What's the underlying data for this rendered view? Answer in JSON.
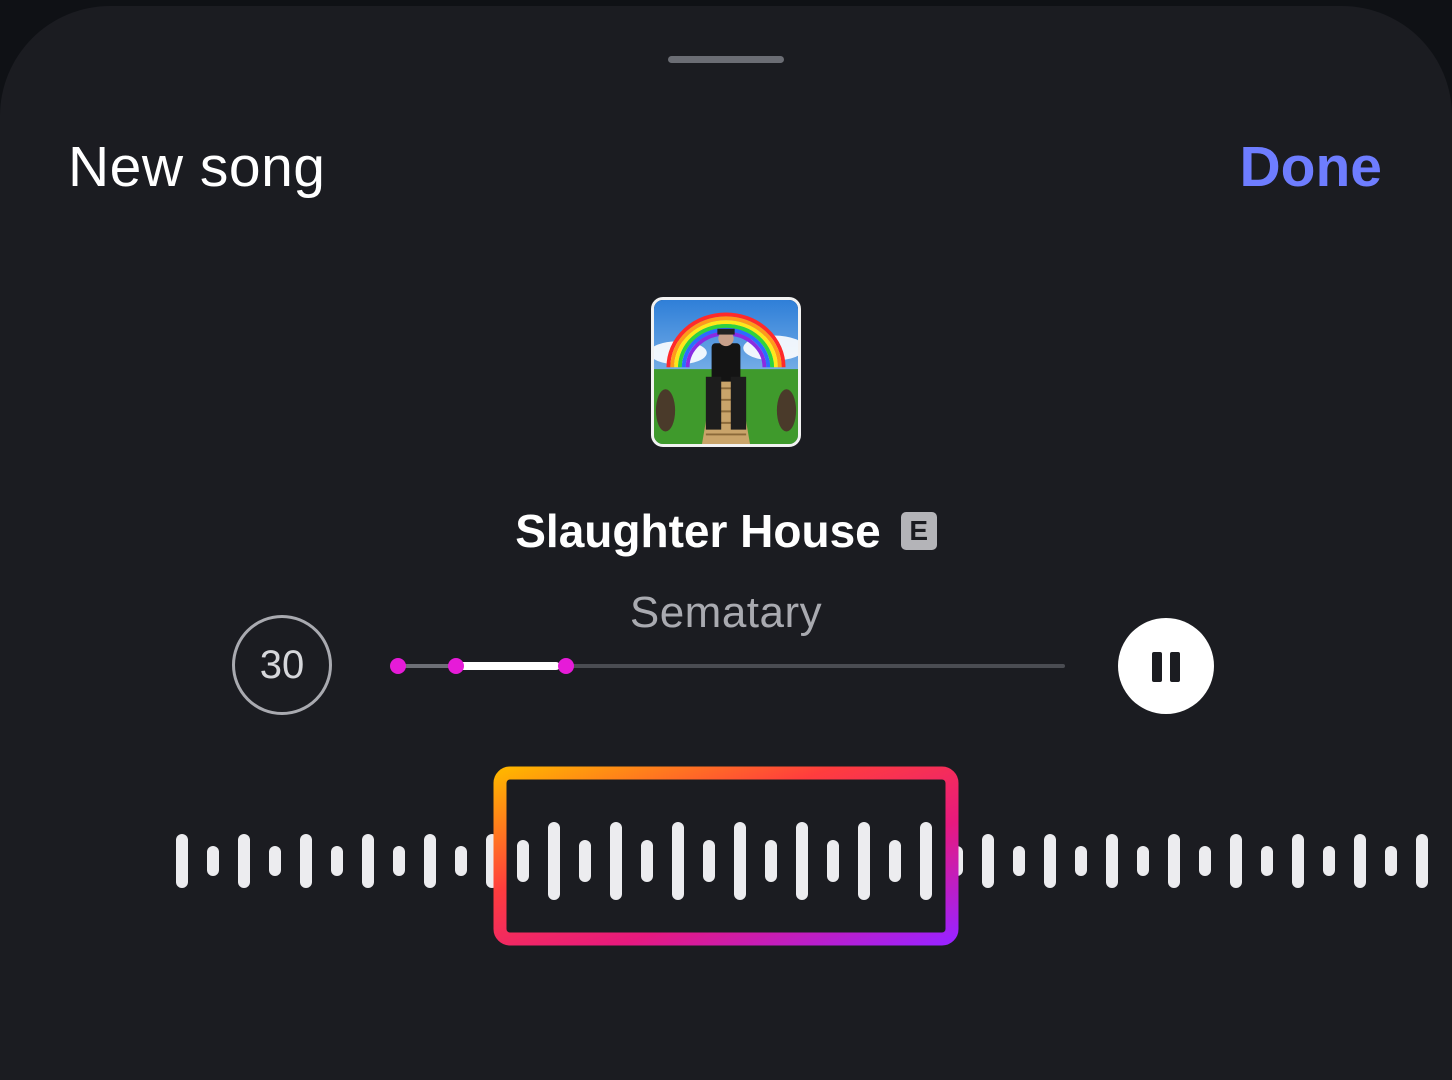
{
  "header": {
    "title": "New song",
    "done_label": "Done"
  },
  "track": {
    "title": "Slaughter House",
    "explicit_badge": "E",
    "artist": "Sematary",
    "artwork_icon": "album-artwork"
  },
  "controls": {
    "duration_label": "30",
    "pause_icon": "pause-icon"
  },
  "scrubber": {
    "selection_start": 0.09,
    "selection_end": 0.26,
    "playhead": 0.24
  },
  "waveform": {
    "selection_start_fraction": 0.34,
    "selection_end_fraction": 0.66
  },
  "colors": {
    "background": "#1b1c21",
    "accent_blue": "#6e7dff",
    "magenta": "#e61bd8",
    "gradient": [
      "#ffb300",
      "#ff3d3d",
      "#e7197e",
      "#9b22ff"
    ]
  }
}
